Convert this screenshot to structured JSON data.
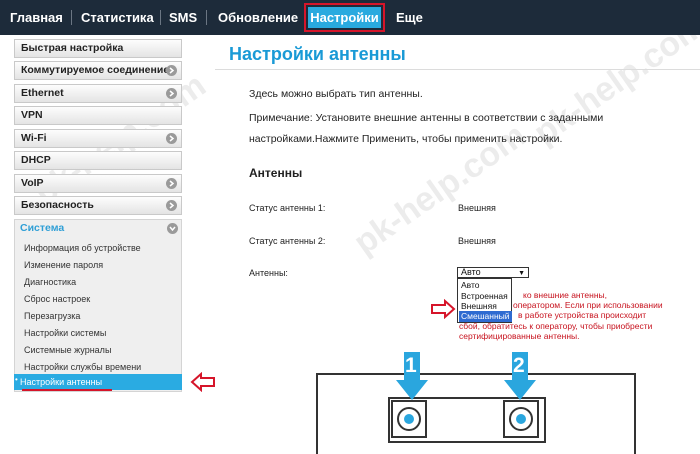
{
  "nav": {
    "items": [
      "Главная",
      "Статистика",
      "SMS",
      "Обновление",
      "Настройки",
      "Еще"
    ],
    "active": "Настройки"
  },
  "sidebar": {
    "items": [
      {
        "label": "Быстрая настройка",
        "arrow": false
      },
      {
        "label": "Коммутируемое соединение",
        "arrow": true
      },
      {
        "label": "Ethernet",
        "arrow": true
      },
      {
        "label": "VPN",
        "arrow": false
      },
      {
        "label": "Wi-Fi",
        "arrow": true
      },
      {
        "label": "DHCP",
        "arrow": false
      },
      {
        "label": "VoIP",
        "arrow": true
      },
      {
        "label": "Безопасность",
        "arrow": true
      }
    ],
    "system_label": "Система",
    "system_items": [
      "Информация об устройстве",
      "Изменение пароля",
      "Диагностика",
      "Сброс настроек",
      "Перезагрузка",
      "Настройки системы",
      "Системные журналы",
      "Настройки службы времени"
    ],
    "active_item": "Настройки антенны"
  },
  "main": {
    "title": "Настройки антенны",
    "intro": "Здесь можно выбрать тип антенны.",
    "note_line1": "Примечание: Установите внешние антенны в соответствии с заданными",
    "note_line2": "настройками.Нажмите Применить, чтобы применить настройки.",
    "section_title": "Антенны",
    "status1_label": "Статус антенны 1:",
    "status1_value": "Внешняя",
    "status2_label": "Статус антенны 2:",
    "status2_value": "Внешняя",
    "antenna_label": "Антенны:",
    "select_value": "Авто",
    "options": [
      "Авто",
      "Встроенная",
      "Внешняя",
      "Смешанный"
    ],
    "selected_option": "Смешанный",
    "warning": [
      "ко внешние антенны,",
      "оператором. Если при использовании",
      "в работе устройства происходит",
      "сбой, обратитесь к оператору, чтобы приобрести",
      "сертифицированные антенны."
    ],
    "callout_1": "1",
    "callout_2": "2"
  },
  "colors": {
    "nav_bg": "#1d2b3a",
    "accent": "#29aadf",
    "highlight_red": "#d6152a",
    "callout_blue": "#2aa6de"
  }
}
